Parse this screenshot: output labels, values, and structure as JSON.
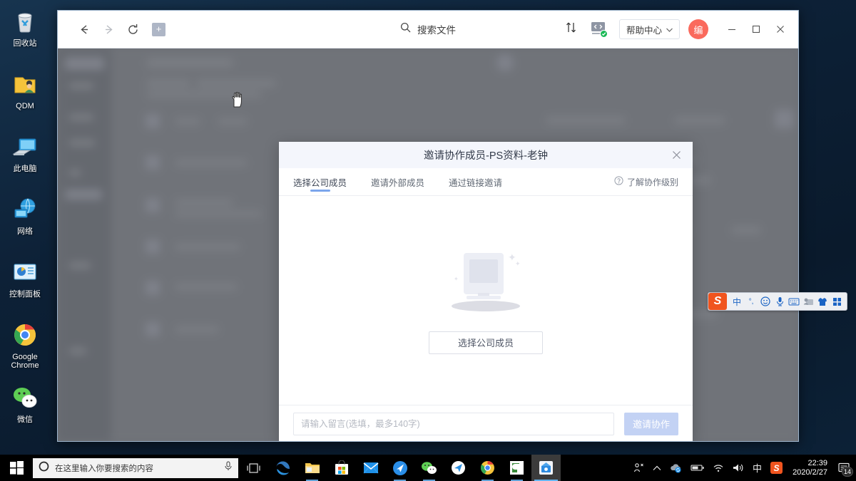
{
  "desktop": {
    "icons": [
      {
        "label": "回收站",
        "icon": "recycle-bin-icon"
      },
      {
        "label": "QDM",
        "icon": "folder-user-icon"
      },
      {
        "label": "此电脑",
        "icon": "this-pc-icon"
      },
      {
        "label": "网络",
        "icon": "network-icon"
      },
      {
        "label": "控制面板",
        "icon": "control-panel-icon"
      },
      {
        "label": "Google Chrome",
        "icon": "chrome-icon"
      },
      {
        "label": "微信",
        "icon": "wechat-icon"
      }
    ]
  },
  "app_window": {
    "toolbar": {
      "back_icon": "arrow-left-icon",
      "forward_icon": "arrow-right-icon",
      "refresh_icon": "refresh-icon",
      "new_tab_label": "+",
      "search_placeholder": "搜索文件",
      "search_icon": "search-icon",
      "sort_icon": "sort-icon",
      "screen_icon": "screen-share-icon",
      "help_center_label": "帮助中心",
      "help_center_caret": "chevron-down-icon",
      "avatar_label": "编",
      "minimize_label": "—",
      "maximize_label": "▢",
      "close_label": "✕"
    }
  },
  "modal": {
    "title": "邀请协作成员-PS资料-老钟",
    "close_icon": "close-icon",
    "tabs": [
      {
        "label": "选择公司成员",
        "active": true
      },
      {
        "label": "邀请外部成员",
        "active": false
      },
      {
        "label": "通过链接邀请",
        "active": false
      }
    ],
    "help_link": {
      "icon": "question-circle-icon",
      "label": "了解协作级别"
    },
    "empty_state": {
      "illustration": "empty-monitor-illustration",
      "action_label": "选择公司成员"
    },
    "footer": {
      "message_placeholder": "请输入留言(选填，最多140字)",
      "message_value": "",
      "submit_label": "邀请协作"
    },
    "colors": {
      "header_bg": "#f4f6fc",
      "active_tab_underline": "#7ba5ec",
      "submit_disabled_bg": "#c3d2f4",
      "avatar_bg": "#fa6a5d"
    }
  },
  "ime_bar": {
    "logo_label": "S",
    "items": [
      {
        "icon": "chinese-mode-icon",
        "label": "中"
      },
      {
        "icon": "punctuation-icon",
        "label": "°,"
      },
      {
        "icon": "emoji-icon",
        "label": "☺"
      },
      {
        "icon": "microphone-icon",
        "label": "🎤"
      },
      {
        "icon": "soft-keyboard-icon",
        "label": "⌨"
      },
      {
        "icon": "user-card-icon",
        "label": "👤"
      },
      {
        "icon": "skin-icon",
        "label": "👕"
      },
      {
        "icon": "toolbox-icon",
        "label": "▦"
      }
    ]
  },
  "taskbar": {
    "start_icon": "windows-start-icon",
    "search_placeholder": "在这里输入你要搜索的内容",
    "search_circle_icon": "cortana-circle-icon",
    "mic_icon": "microphone-icon",
    "task_view_icon": "task-view-icon",
    "apps": [
      {
        "name": "edge",
        "label": "e",
        "state": "idle"
      },
      {
        "name": "file-explorer",
        "label": "",
        "state": "running"
      },
      {
        "name": "microsoft-store",
        "label": "",
        "state": "idle"
      },
      {
        "name": "mail",
        "label": "",
        "state": "idle"
      },
      {
        "name": "blue-app",
        "label": "",
        "state": "running"
      },
      {
        "name": "wechat",
        "label": "",
        "state": "running"
      },
      {
        "name": "telegram",
        "label": "",
        "state": "idle"
      },
      {
        "name": "chrome",
        "label": "",
        "state": "running"
      },
      {
        "name": "coding-app",
        "label": "C",
        "state": "running"
      },
      {
        "name": "qdm-disk",
        "label": "",
        "state": "active"
      }
    ],
    "tray": [
      {
        "icon": "person-share-icon",
        "label": "⧔"
      },
      {
        "icon": "chevron-up-icon",
        "label": "︿"
      },
      {
        "icon": "cloud-sync-icon",
        "label": ""
      },
      {
        "icon": "battery-icon",
        "label": ""
      },
      {
        "icon": "wifi-icon",
        "label": ""
      },
      {
        "icon": "volume-icon",
        "label": ""
      },
      {
        "icon": "ime-chinese-icon",
        "label": "中"
      },
      {
        "icon": "sogou-ime-icon",
        "label": "S"
      }
    ],
    "clock": {
      "time": "22:39",
      "date": "2020/2/27"
    },
    "notifications": {
      "icon": "action-center-icon",
      "count": "14"
    }
  }
}
